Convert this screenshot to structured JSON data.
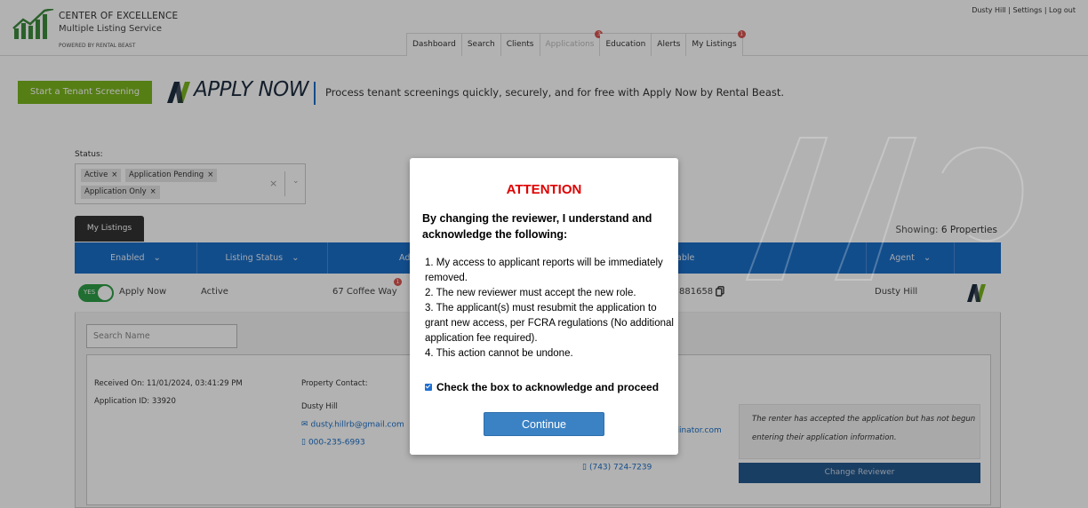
{
  "header": {
    "brand_line1": "CENTER OF EXCELLENCE",
    "brand_line2": "Multiple Listing Service",
    "brand_line3": "POWERED BY RENTAL BEAST",
    "user_nav": "Dusty Hill | Settings | Log out",
    "tabs": [
      {
        "label": "Dashboard",
        "badge": ""
      },
      {
        "label": "Search",
        "badge": ""
      },
      {
        "label": "Clients",
        "badge": ""
      },
      {
        "label": "Applications",
        "badge": "3"
      },
      {
        "label": "Education",
        "badge": ""
      },
      {
        "label": "Alerts",
        "badge": ""
      },
      {
        "label": "My Listings",
        "badge": "1"
      }
    ]
  },
  "apply_bar": {
    "start_button": "Start a Tenant Screening",
    "logo_text": "APPLY NOW",
    "description": "Process tenant screenings quickly, securely, and for free with Apply Now by Rental Beast."
  },
  "filters": {
    "status_label": "Status:",
    "chips": [
      "Active",
      "Application Pending",
      "Application Only"
    ],
    "my_listings_button": "My Listings",
    "showing_prefix": "Showing:",
    "showing_value": "6 Properties"
  },
  "table": {
    "headers": [
      "Enabled",
      "Listing Status",
      "Ad",
      "able Link",
      "Agent"
    ],
    "row": {
      "toggle": "YES",
      "apply": "Apply Now",
      "status": "Active",
      "address": "67 Coffee Way",
      "address_badge": "1",
      "link_id": "881658",
      "agent": "Dusty Hill"
    }
  },
  "panel": {
    "search_placeholder": "Search Name",
    "received_on": "Received On: 11/01/2024, 03:41:29 PM",
    "application_id": "Application ID: 33920",
    "property_contact": "Property Contact:",
    "contact_name": "Dusty Hill",
    "contact_email": "dusty.hillrb@gmail.com",
    "contact_phone": "000-235-6993",
    "renter_email_fragment": "ilinator.com",
    "renter_phone": "(743) 724-7239",
    "note": "The renter has accepted the application but has not begun entering their application information.",
    "change_reviewer": "Change Reviewer"
  },
  "modal": {
    "title": "ATTENTION",
    "lead": "By changing the reviewer, I understand and acknowledge the following:",
    "items": [
      "1. My access to applicant reports will be immediately removed.",
      "2. The new reviewer must accept the new role.",
      "3. The applicant(s) must resubmit the application to grant new access, per FCRA regulations (No additional application fee required).",
      "4. This action cannot be undone."
    ],
    "checkbox_label": "Check the box to acknowledge and proceed",
    "checkbox_checked": true,
    "continue": "Continue"
  },
  "colors": {
    "primary_blue": "#1b6fc7",
    "green": "#7ab51d",
    "attention_red": "#e00000",
    "badge_red": "#d9534f"
  }
}
